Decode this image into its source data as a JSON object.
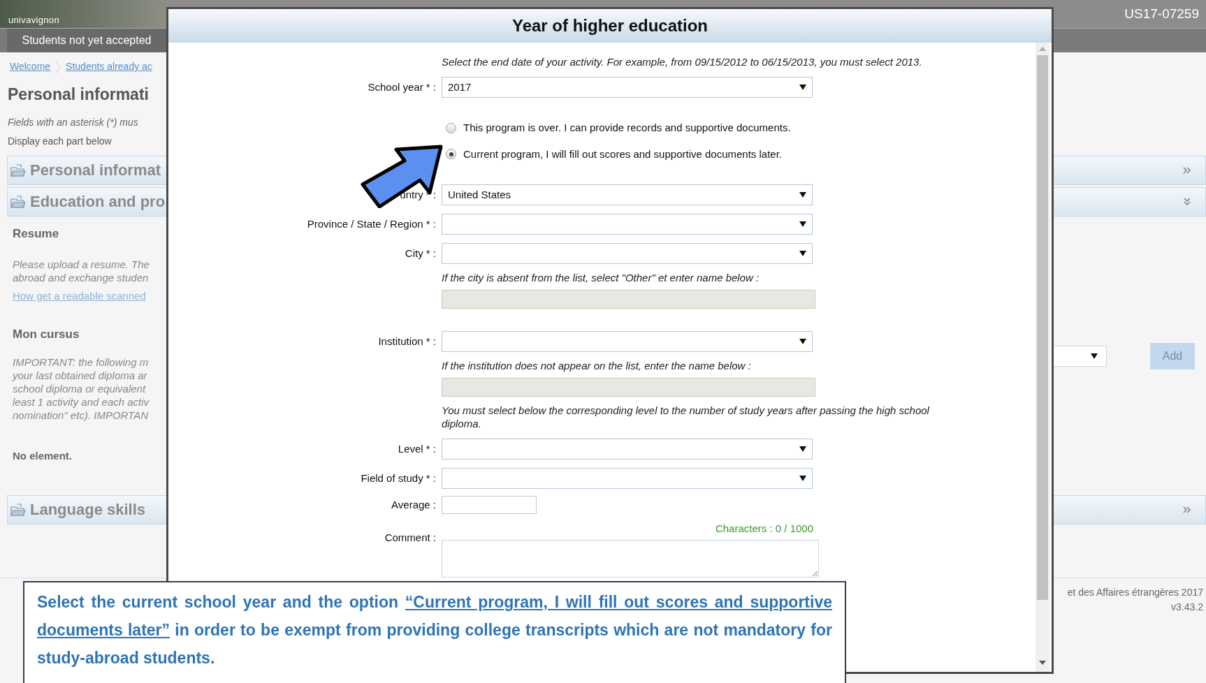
{
  "page": {
    "logo": "univavignon",
    "status_tab": "Students not yet accepted",
    "user_id": "US17-07259",
    "breadcrumb": [
      "Welcome",
      "Students already ac"
    ],
    "heading": "Personal informati",
    "note": "Fields with an asterisk (*) mus",
    "display_hint": "Display each part below",
    "sections": [
      {
        "title": "Personal informat",
        "expanded": false
      },
      {
        "title": "Education and pro",
        "expanded": true
      }
    ],
    "resume": {
      "title": "Resume",
      "lines": [
        "Please upload a resume. The",
        "abroad and exchange studen"
      ],
      "link": "How get a readable scanned"
    },
    "cursus": {
      "title": "Mon cursus",
      "lines": [
        "IMPORTANT: the following m",
        "your last obtained diploma ar",
        "school diploma or equivalent",
        "least 1 activity and each activ",
        "nomination\" etc). IMPORTAN"
      ],
      "empty": "No element.",
      "add_button": "Add"
    },
    "language": {
      "title": "Language skills",
      "expanded": false
    },
    "footer": [
      "et des Affaires étrangères 2017",
      "v3.43.2"
    ]
  },
  "dialog": {
    "title": "Year of higher education",
    "rows": [
      {
        "kind": "hint",
        "text": "Select the end date of your activity. For example, from 09/15/2012 to 06/15/2013, you must select 2013."
      },
      {
        "kind": "select",
        "label": "School year * :",
        "value": "2017"
      },
      {
        "kind": "radio",
        "options": [
          {
            "label": "This program is over. I can provide records and supportive documents.",
            "selected": false
          },
          {
            "label": "Current program, I will fill out scores and supportive documents later.",
            "selected": true
          }
        ]
      },
      {
        "kind": "select",
        "label": "untry * :",
        "value": "United States"
      },
      {
        "kind": "select",
        "label": "Province / State / Region * :"
      },
      {
        "kind": "select",
        "label": "City * :"
      },
      {
        "kind": "hint",
        "text": "If the city is absent from the list, select \"Other\" et enter name below :"
      },
      {
        "kind": "disabled"
      },
      {
        "kind": "select",
        "label": "Institution * :"
      },
      {
        "kind": "hint",
        "text": "If the institution does not appear on the list, enter the name below :"
      },
      {
        "kind": "disabled"
      },
      {
        "kind": "hint",
        "text": "You must select below the corresponding level to the number of study years after passing the high school diploma."
      },
      {
        "kind": "select",
        "label": "Level * :"
      },
      {
        "kind": "select",
        "label": "Field of study * :"
      },
      {
        "kind": "text",
        "label": "Average :"
      },
      {
        "kind": "textarea",
        "label": "Comment :",
        "counter": "Characters : 0 / 1000"
      }
    ]
  },
  "callout": {
    "before": "Select the current school year and the option ",
    "emphasis": "“Current program, I will fill out scores and supportive documents later”",
    "after": " in order to be exempt from providing college transcripts which are not mandatory for study-abroad students."
  }
}
